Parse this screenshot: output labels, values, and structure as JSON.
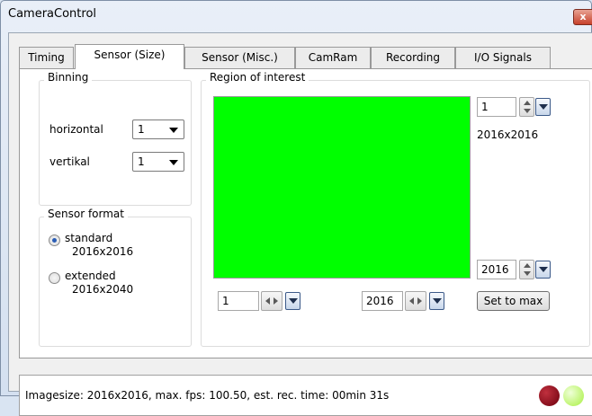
{
  "window": {
    "title": "CameraControl",
    "close_glyph": "x"
  },
  "tabs": [
    {
      "label": "Timing"
    },
    {
      "label": "Sensor (Size)",
      "active": true
    },
    {
      "label": "Sensor (Misc.)"
    },
    {
      "label": "CamRam"
    },
    {
      "label": "Recording"
    },
    {
      "label": "I/O Signals"
    }
  ],
  "binning": {
    "title": "Binning",
    "horizontal_label": "horizontal",
    "horizontal_value": "1",
    "vertical_label": "vertikal",
    "vertical_value": "1"
  },
  "sensor_format": {
    "title": "Sensor format",
    "standard_line1": "standard",
    "standard_line2": "2016x2016",
    "extended_line1": "extended",
    "extended_line2": "2016x2040",
    "selected": "standard"
  },
  "roi": {
    "title": "Region of interest",
    "preview_color": "#00ff00",
    "y_start_value": "1",
    "size_text": "2016x2016",
    "y_end_value": "2016",
    "x_start_value": "1",
    "x_end_value": "2016",
    "set_to_max_label": "Set to max"
  },
  "status": {
    "text": "Imagesize: 2016x2016, max. fps: 100.50, est. rec. time: 00min 31s",
    "led_record_color": "#7a0010",
    "led_ready_color": "#b7f55a"
  }
}
